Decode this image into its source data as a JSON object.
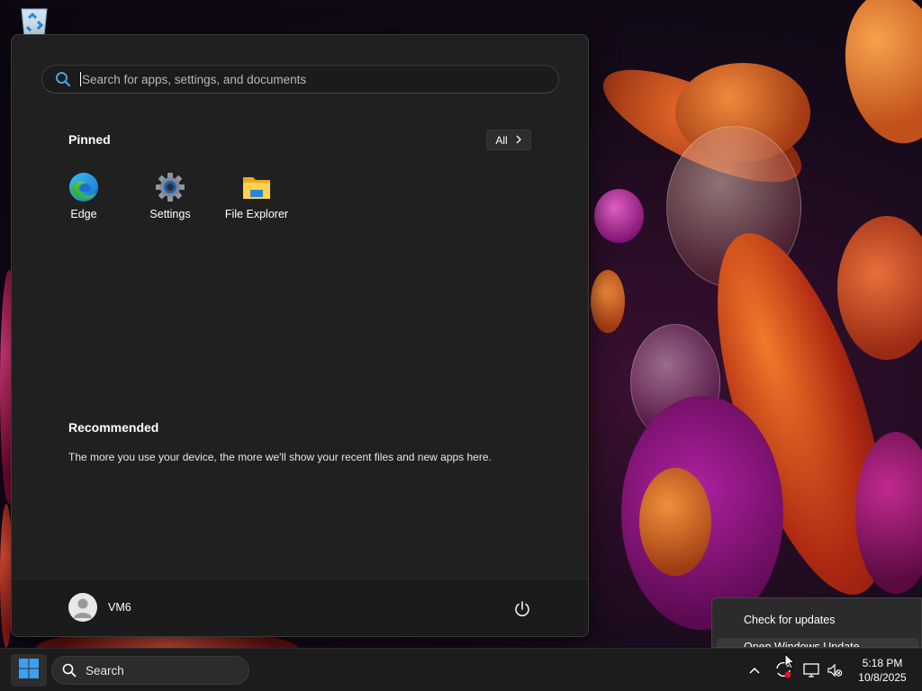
{
  "start_menu": {
    "search_placeholder": "Search for apps, settings, and documents",
    "pinned_title": "Pinned",
    "all_button": "All",
    "pinned_apps": [
      {
        "label": "Edge",
        "icon": "edge-icon"
      },
      {
        "label": "Settings",
        "icon": "settings-gear-icon"
      },
      {
        "label": "File Explorer",
        "icon": "folder-icon"
      }
    ],
    "recommended_title": "Recommended",
    "recommended_text": "The more you use your device, the more we'll show your recent files and new apps here.",
    "user_name": "VM6"
  },
  "context_menu": {
    "items": [
      {
        "label": "Check for updates"
      },
      {
        "label": "Open Windows Update"
      }
    ]
  },
  "taskbar": {
    "search_label": "Search",
    "time": "5:18 PM",
    "date": "10/8/2025"
  },
  "colors": {
    "accent": "#0078d4",
    "menu_bg": "#202020",
    "taskbar_bg": "#1c1c1c"
  }
}
